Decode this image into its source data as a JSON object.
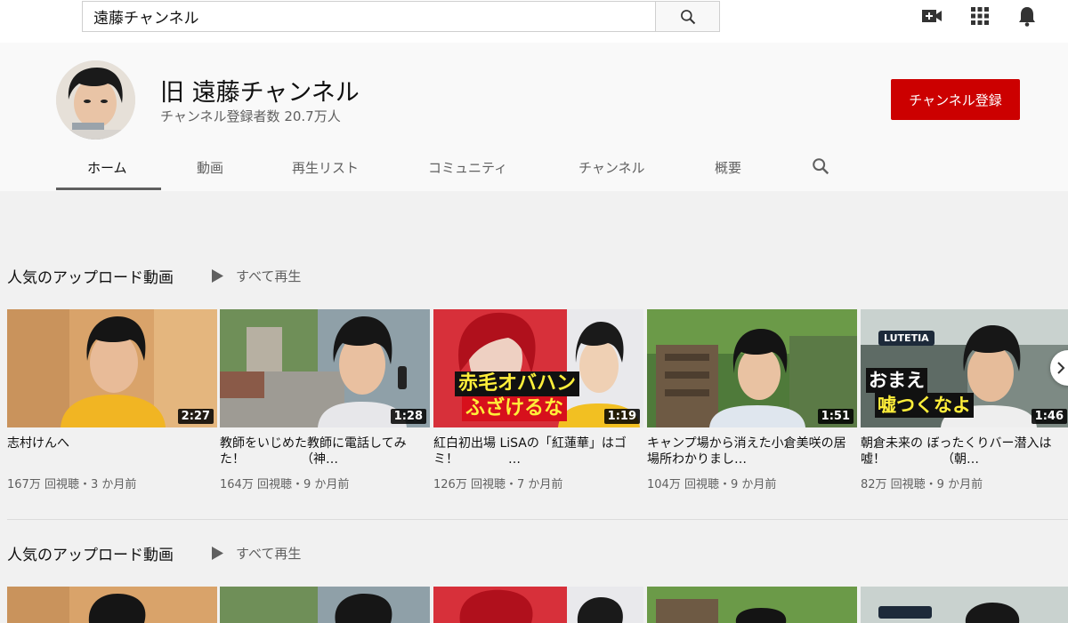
{
  "search": {
    "value": "遠藤チャンネル"
  },
  "channel": {
    "title": "旧 遠藤チャンネル",
    "subscribers": "チャンネル登録者数 20.7万人",
    "subscribe_label": "チャンネル登録"
  },
  "tabs": [
    "ホーム",
    "動画",
    "再生リスト",
    "コミュニティ",
    "チャンネル",
    "概要"
  ],
  "shelves": [
    {
      "title": "人気のアップロード動画",
      "play_all": "すべて再生"
    },
    {
      "title": "人気のアップロード動画",
      "play_all": "すべて再生"
    }
  ],
  "videos": [
    {
      "title": "志村けんへ",
      "meta": "167万 回視聴・3 か月前",
      "duration": "2:27",
      "overlay": []
    },
    {
      "title": "教師をいじめた教師に電話してみた！　　　　　（神…",
      "meta": "164万 回視聴・9 か月前",
      "duration": "1:28",
      "overlay": []
    },
    {
      "title": "紅白初出場 LiSAの「紅蓮華」はゴミ！　　　　…",
      "meta": "126万 回視聴・7 か月前",
      "duration": "1:19",
      "overlay": [
        "赤毛オバハン",
        "ふざけるな"
      ]
    },
    {
      "title": "キャンプ場から消えた小倉美咲の居場所わかりまし…",
      "meta": "104万 回視聴・9 か月前",
      "duration": "1:51",
      "overlay": []
    },
    {
      "title": "朝倉未来の ぼったくりバー潜入は嘘！　　　　　（朝…",
      "meta": "82万 回視聴・9 か月前",
      "duration": "1:46",
      "overlay": [
        "おまえ",
        "嘘つくなよ"
      ],
      "sign": "LUTETIA"
    }
  ],
  "colors": {
    "subscribe": "#cc0000",
    "header_bg": "#f9f9f9",
    "page_bg": "#f1f1f1"
  }
}
